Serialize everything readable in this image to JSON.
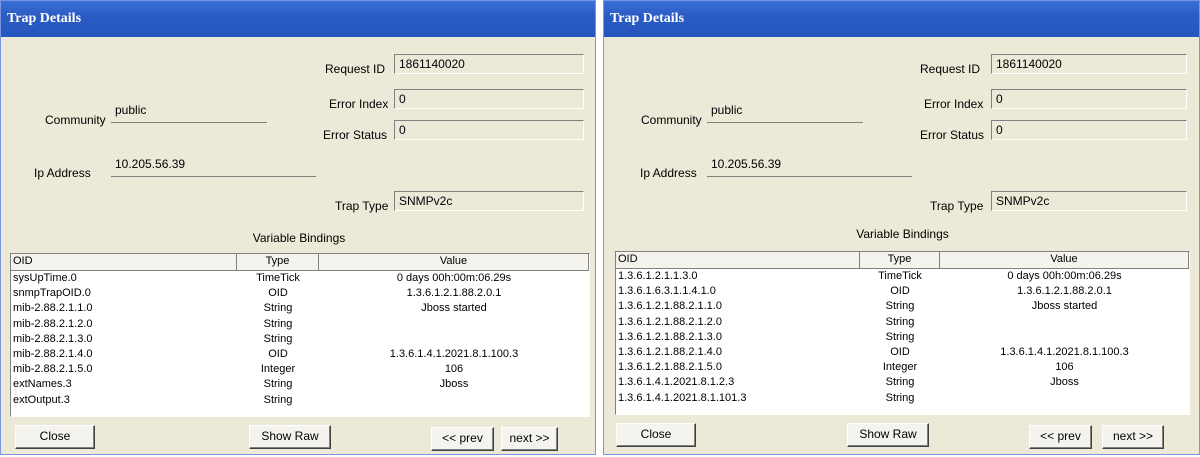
{
  "panels": [
    {
      "title": "Trap Details",
      "request_id_label": "Request ID",
      "request_id": "1861140020",
      "error_index_label": "Error Index",
      "error_index": "0",
      "error_status_label": "Error Status",
      "error_status": "0",
      "community_label": "Community",
      "community": "public",
      "ip_label": "Ip Address",
      "ip": "10.205.56.39",
      "trap_type_label": "Trap Type",
      "trap_type": "SNMPv2c",
      "bindings_label": "Variable Bindings",
      "columns": [
        "OID",
        "Type",
        "Value"
      ],
      "rows": [
        [
          "sysUpTime.0",
          "TimeTick",
          "0 days 00h:00m:06.29s"
        ],
        [
          "snmpTrapOID.0",
          "OID",
          "1.3.6.1.2.1.88.2.0.1"
        ],
        [
          "mib-2.88.2.1.1.0",
          "String",
          "Jboss started"
        ],
        [
          "mib-2.88.2.1.2.0",
          "String",
          ""
        ],
        [
          "mib-2.88.2.1.3.0",
          "String",
          ""
        ],
        [
          "mib-2.88.2.1.4.0",
          "OID",
          "1.3.6.1.4.1.2021.8.1.100.3"
        ],
        [
          "mib-2.88.2.1.5.0",
          "Integer",
          "106"
        ],
        [
          "extNames.3",
          "String",
          "Jboss"
        ],
        [
          "extOutput.3",
          "String",
          ""
        ]
      ],
      "close_label": "Close",
      "show_raw_label": "Show Raw",
      "prev_label": "<< prev",
      "next_label": "next >>"
    },
    {
      "title": "Trap Details",
      "request_id_label": "Request ID",
      "request_id": "1861140020",
      "error_index_label": "Error Index",
      "error_index": "0",
      "error_status_label": "Error Status",
      "error_status": "0",
      "community_label": "Community",
      "community": "public",
      "ip_label": "Ip Address",
      "ip": "10.205.56.39",
      "trap_type_label": "Trap Type",
      "trap_type": "SNMPv2c",
      "bindings_label": "Variable Bindings",
      "columns": [
        "OID",
        "Type",
        "Value"
      ],
      "rows": [
        [
          "1.3.6.1.2.1.1.3.0",
          "TimeTick",
          "0 days 00h:00m:06.29s"
        ],
        [
          "1.3.6.1.6.3.1.1.4.1.0",
          "OID",
          "1.3.6.1.2.1.88.2.0.1"
        ],
        [
          "1.3.6.1.2.1.88.2.1.1.0",
          "String",
          "Jboss started"
        ],
        [
          "1.3.6.1.2.1.88.2.1.2.0",
          "String",
          ""
        ],
        [
          "1.3.6.1.2.1.88.2.1.3.0",
          "String",
          ""
        ],
        [
          "1.3.6.1.2.1.88.2.1.4.0",
          "OID",
          "1.3.6.1.4.1.2021.8.1.100.3"
        ],
        [
          "1.3.6.1.2.1.88.2.1.5.0",
          "Integer",
          "106"
        ],
        [
          "1.3.6.1.4.1.2021.8.1.2.3",
          "String",
          "Jboss"
        ],
        [
          "1.3.6.1.4.1.2021.8.1.101.3",
          "String",
          ""
        ]
      ],
      "close_label": "Close",
      "show_raw_label": "Show Raw",
      "prev_label": "<< prev",
      "next_label": "next >>"
    }
  ]
}
